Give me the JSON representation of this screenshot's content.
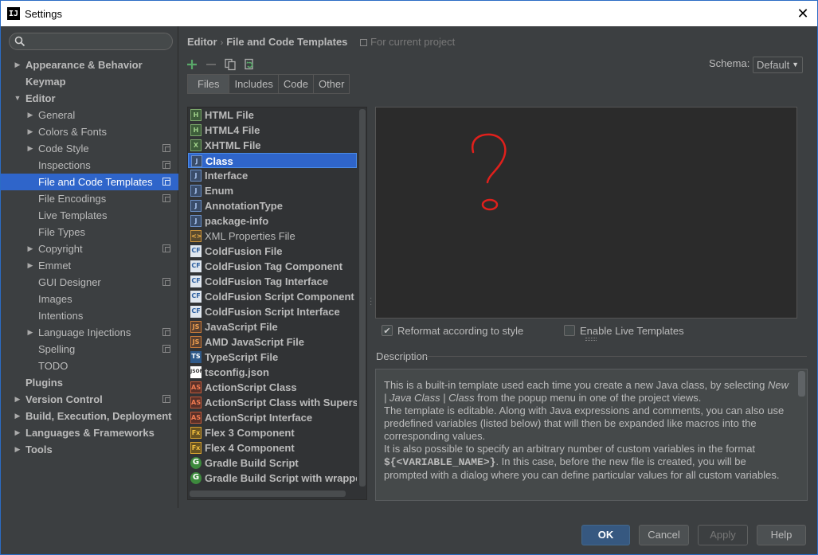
{
  "window": {
    "title": "Settings",
    "app_icon": "IJ"
  },
  "search": {
    "placeholder": ""
  },
  "sidebar": {
    "items": [
      {
        "label": "Appearance & Behavior",
        "level": 0,
        "expandable": true,
        "expanded": false,
        "project": false
      },
      {
        "label": "Keymap",
        "level": 0,
        "expandable": false,
        "expanded": false,
        "project": false
      },
      {
        "label": "Editor",
        "level": 0,
        "expandable": true,
        "expanded": true,
        "project": false
      },
      {
        "label": "General",
        "level": 1,
        "expandable": true,
        "expanded": false,
        "project": false
      },
      {
        "label": "Colors & Fonts",
        "level": 1,
        "expandable": true,
        "expanded": false,
        "project": false
      },
      {
        "label": "Code Style",
        "level": 1,
        "expandable": true,
        "expanded": false,
        "project": true
      },
      {
        "label": "Inspections",
        "level": 1,
        "expandable": false,
        "expanded": false,
        "project": true
      },
      {
        "label": "File and Code Templates",
        "level": 1,
        "expandable": false,
        "expanded": false,
        "project": true,
        "selected": true
      },
      {
        "label": "File Encodings",
        "level": 1,
        "expandable": false,
        "expanded": false,
        "project": true
      },
      {
        "label": "Live Templates",
        "level": 1,
        "expandable": false,
        "expanded": false,
        "project": false
      },
      {
        "label": "File Types",
        "level": 1,
        "expandable": false,
        "expanded": false,
        "project": false
      },
      {
        "label": "Copyright",
        "level": 1,
        "expandable": true,
        "expanded": false,
        "project": true
      },
      {
        "label": "Emmet",
        "level": 1,
        "expandable": true,
        "expanded": false,
        "project": false
      },
      {
        "label": "GUI Designer",
        "level": 1,
        "expandable": false,
        "expanded": false,
        "project": true
      },
      {
        "label": "Images",
        "level": 1,
        "expandable": false,
        "expanded": false,
        "project": false
      },
      {
        "label": "Intentions",
        "level": 1,
        "expandable": false,
        "expanded": false,
        "project": false
      },
      {
        "label": "Language Injections",
        "level": 1,
        "expandable": true,
        "expanded": false,
        "project": true
      },
      {
        "label": "Spelling",
        "level": 1,
        "expandable": false,
        "expanded": false,
        "project": true
      },
      {
        "label": "TODO",
        "level": 1,
        "expandable": false,
        "expanded": false,
        "project": false
      },
      {
        "label": "Plugins",
        "level": 0,
        "expandable": false,
        "expanded": false,
        "project": false
      },
      {
        "label": "Version Control",
        "level": 0,
        "expandable": true,
        "expanded": false,
        "project": true
      },
      {
        "label": "Build, Execution, Deployment",
        "level": 0,
        "expandable": true,
        "expanded": false,
        "project": false
      },
      {
        "label": "Languages & Frameworks",
        "level": 0,
        "expandable": true,
        "expanded": false,
        "project": false
      },
      {
        "label": "Tools",
        "level": 0,
        "expandable": true,
        "expanded": false,
        "project": false
      }
    ]
  },
  "breadcrumb": {
    "parent": "Editor",
    "sep": "›",
    "current": "File and Code Templates",
    "scope": "For current project"
  },
  "schema": {
    "label": "Schema:",
    "value": "Default"
  },
  "tabs": [
    {
      "label": "Files",
      "active": true
    },
    {
      "label": "Includes",
      "active": false
    },
    {
      "label": "Code",
      "active": false
    },
    {
      "label": "Other",
      "active": false
    }
  ],
  "files": [
    {
      "label": "HTML File",
      "icon": "html",
      "glyph": "H",
      "bold": true
    },
    {
      "label": "HTML4 File",
      "icon": "html",
      "glyph": "H",
      "bold": true
    },
    {
      "label": "XHTML File",
      "icon": "html",
      "glyph": "X",
      "bold": true
    },
    {
      "label": "Class",
      "icon": "java",
      "glyph": "J",
      "bold": true,
      "selected": true
    },
    {
      "label": "Interface",
      "icon": "java",
      "glyph": "J",
      "bold": true
    },
    {
      "label": "Enum",
      "icon": "java",
      "glyph": "J",
      "bold": true
    },
    {
      "label": "AnnotationType",
      "icon": "java",
      "glyph": "J",
      "bold": true
    },
    {
      "label": "package-info",
      "icon": "java",
      "glyph": "J",
      "bold": true
    },
    {
      "label": "XML Properties File",
      "icon": "xml",
      "glyph": "<>",
      "bold": false
    },
    {
      "label": "ColdFusion File",
      "icon": "cf",
      "glyph": "CF",
      "bold": true
    },
    {
      "label": "ColdFusion Tag Component",
      "icon": "cf",
      "glyph": "CF",
      "bold": true
    },
    {
      "label": "ColdFusion Tag Interface",
      "icon": "cf",
      "glyph": "CF",
      "bold": true
    },
    {
      "label": "ColdFusion Script Component",
      "icon": "cf",
      "glyph": "CF",
      "bold": true
    },
    {
      "label": "ColdFusion Script Interface",
      "icon": "cf",
      "glyph": "CF",
      "bold": true
    },
    {
      "label": "JavaScript File",
      "icon": "js",
      "glyph": "JS",
      "bold": true
    },
    {
      "label": "AMD JavaScript File",
      "icon": "js",
      "glyph": "JS",
      "bold": true
    },
    {
      "label": "TypeScript File",
      "icon": "ts",
      "glyph": "TS",
      "bold": true
    },
    {
      "label": "tsconfig.json",
      "icon": "json",
      "glyph": "JSON",
      "bold": true
    },
    {
      "label": "ActionScript Class",
      "icon": "as",
      "glyph": "AS",
      "bold": true
    },
    {
      "label": "ActionScript Class with Supers",
      "icon": "as",
      "glyph": "AS",
      "bold": true
    },
    {
      "label": "ActionScript Interface",
      "icon": "as",
      "glyph": "AS",
      "bold": true
    },
    {
      "label": "Flex 3 Component",
      "icon": "flex",
      "glyph": "Fx",
      "bold": true
    },
    {
      "label": "Flex 4 Component",
      "icon": "flex",
      "glyph": "Fx",
      "bold": true
    },
    {
      "label": "Gradle Build Script",
      "icon": "gradle",
      "glyph": "G",
      "bold": true
    },
    {
      "label": "Gradle Build Script with wrapper",
      "icon": "gradle",
      "glyph": "G",
      "bold": true
    }
  ],
  "editor": {
    "content": "",
    "annotation_color": "#e0201c"
  },
  "options": {
    "reformat": {
      "label": "Reformat according to style",
      "checked": true
    },
    "live_templates": {
      "label": "Enable Live Templates",
      "checked": false
    }
  },
  "description": {
    "title": "Description",
    "p1_before": "This is a built-in template used each time you create a new Java class, by selecting ",
    "p1_em": "New | Java Class | Class",
    "p1_after": " from the popup menu in one of the project views.",
    "p2": "The template is editable. Along with Java expressions and comments, you can also use predefined variables (listed below) that will then be expanded like macros into the corresponding values.",
    "p3_before": "It is also possible to specify an arbitrary number of custom variables in the format ",
    "p3_code": "${<VARIABLE_NAME>}",
    "p3_after": ". In this case, before the new file is created, you will be prompted with a dialog where you can define particular values for all custom variables."
  },
  "buttons": {
    "ok": "OK",
    "cancel": "Cancel",
    "apply": "Apply",
    "help": "Help"
  },
  "colors": {
    "accent": "#2f65ca",
    "background": "#3c3f41",
    "editor_bg": "#2b2b2b"
  }
}
